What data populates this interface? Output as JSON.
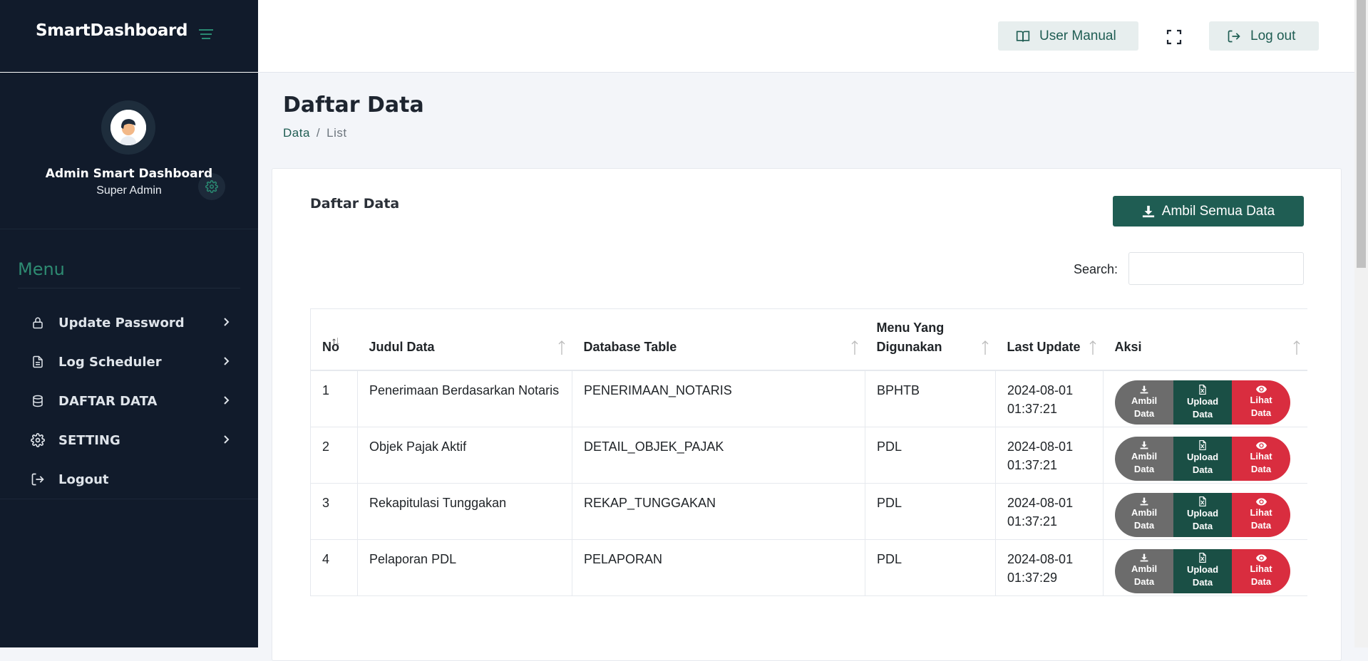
{
  "app": {
    "brand": "SmartDashboard"
  },
  "topbar": {
    "user_manual_label": "User Manual",
    "logout_label": "Log out"
  },
  "profile": {
    "name": "Admin Smart Dashboard",
    "role": "Super Admin"
  },
  "sidebar": {
    "menu_title": "Menu",
    "items": [
      {
        "label": "Update Password",
        "icon": "lock-icon"
      },
      {
        "label": "Log Scheduler",
        "icon": "file-icon"
      },
      {
        "label": "DAFTAR DATA",
        "icon": "database-icon"
      },
      {
        "label": "SETTING",
        "icon": "gear-icon"
      },
      {
        "label": "Logout",
        "icon": "logout-icon"
      }
    ]
  },
  "page": {
    "title": "Daftar Data",
    "breadcrumb": {
      "link": "Data",
      "current": "List"
    }
  },
  "card": {
    "title": "Daftar Data",
    "fetch_all_label": "Ambil Semua Data",
    "search_label": "Search:",
    "search_value": ""
  },
  "table": {
    "headers": {
      "no": "No",
      "judul": "Judul Data",
      "db": "Database Table",
      "menu_line1": "Menu Yang",
      "menu_line2": "Digunakan",
      "last_update": "Last Update",
      "aksi": "Aksi"
    },
    "action_labels": {
      "fetch_line1": "Ambil",
      "fetch_line2": "Data",
      "upload_line1": "Upload",
      "upload_line2": "Data",
      "view_line1": "Lihat",
      "view_line2": "Data"
    },
    "rows": [
      {
        "no": "1",
        "judul": "Penerimaan Berdasarkan Notaris",
        "db": "PENERIMAAN_NOTARIS",
        "menu": "BPHTB",
        "date": "2024-08-01",
        "time": "01:37:21"
      },
      {
        "no": "2",
        "judul": "Objek Pajak Aktif",
        "db": "DETAIL_OBJEK_PAJAK",
        "menu": "PDL",
        "date": "2024-08-01",
        "time": "01:37:21"
      },
      {
        "no": "3",
        "judul": "Rekapitulasi Tunggakan",
        "db": "REKAP_TUNGGAKAN",
        "menu": "PDL",
        "date": "2024-08-01",
        "time": "01:37:21"
      },
      {
        "no": "4",
        "judul": "Pelaporan PDL",
        "db": "PELAPORAN",
        "menu": "PDL",
        "date": "2024-08-01",
        "time": "01:37:29"
      }
    ]
  },
  "colors": {
    "sidebar_bg": "#111b2b",
    "accent": "#1f5d53",
    "action_grey": "#6c6c6c",
    "action_green": "#1a4f45",
    "action_red": "#d92d3f"
  }
}
